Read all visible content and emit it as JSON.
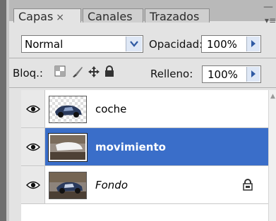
{
  "tabs": [
    {
      "label": "Capas",
      "close": "×"
    },
    {
      "label": "Canales"
    },
    {
      "label": "Trazados"
    }
  ],
  "panel_controls": {
    "minimize": "—",
    "menu": "▾≡"
  },
  "blend_mode": {
    "value": "Normal"
  },
  "opacity": {
    "label": "Opacidad:",
    "value": "100%"
  },
  "lock": {
    "label": "Bloq.:"
  },
  "fill": {
    "label": "Relleno:",
    "value": "100%"
  },
  "layers": [
    {
      "name": "coche",
      "selected": false,
      "italic": false,
      "locked": false
    },
    {
      "name": "movimiento",
      "selected": true,
      "italic": false,
      "locked": false
    },
    {
      "name": "Fondo",
      "selected": false,
      "italic": true,
      "locked": true
    }
  ],
  "colors": {
    "selection": "#3a6ec9",
    "accent_arrow": "#2f5aa3"
  }
}
